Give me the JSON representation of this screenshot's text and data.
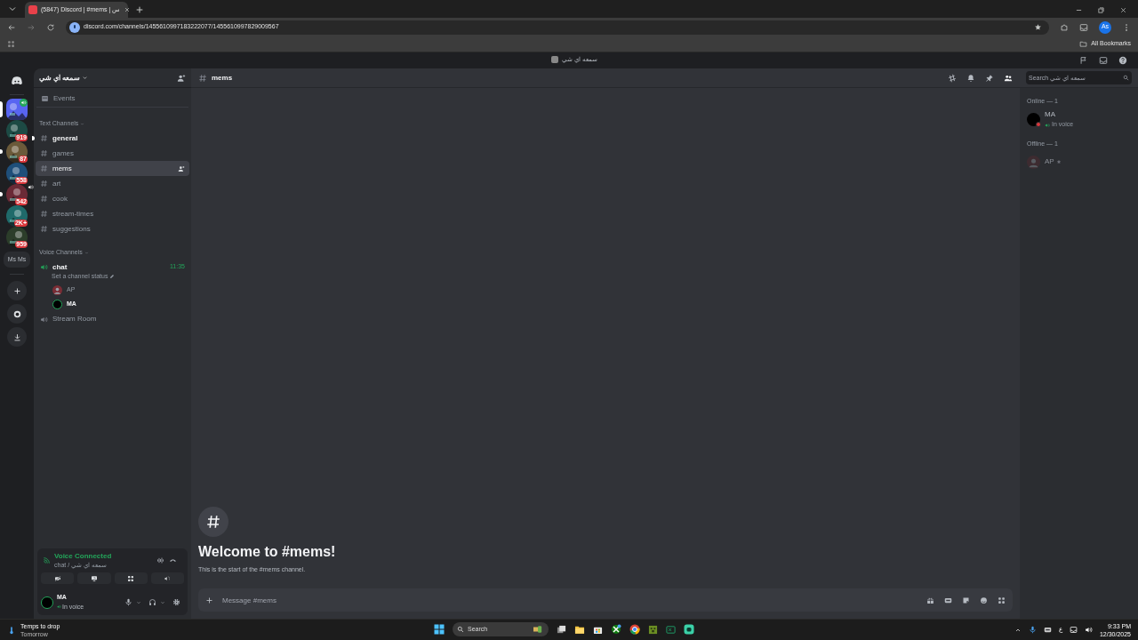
{
  "browser": {
    "tab_title": "(5847) Discord | #mems | س",
    "address": "discord.com/channels/1455610997183222077/1455610997829009567",
    "bookmarks_label": "All Bookmarks",
    "profile_initials": "As"
  },
  "app_title": "سمعه اي شي",
  "servers": [
    {
      "selected": true,
      "speaker": true
    },
    {
      "badge": "919",
      "selected": false,
      "unread": false,
      "speaker": false
    },
    {
      "badge": "87",
      "selected": false,
      "unread": true,
      "speaker": false
    },
    {
      "badge": "558",
      "selected": false,
      "unread": false,
      "speaker": false
    },
    {
      "badge": "542",
      "selected": false,
      "unread": true,
      "speaker": true
    },
    {
      "badge": "2K+",
      "selected": false,
      "unread": false,
      "speaker": false
    },
    {
      "badge": "959",
      "selected": false,
      "unread": false,
      "speaker": false
    }
  ],
  "server_folder": "Ms Ms",
  "server_name": "سمعه اي شي",
  "events_label": "Events",
  "text_category": "Text Channels",
  "text_channels": [
    {
      "name": "general",
      "selected": false,
      "unread": true
    },
    {
      "name": "games",
      "selected": false,
      "unread": false
    },
    {
      "name": "mems",
      "selected": true,
      "unread": false
    },
    {
      "name": "art",
      "selected": false,
      "unread": false
    },
    {
      "name": "cook",
      "selected": false,
      "unread": false
    },
    {
      "name": "stream-times",
      "selected": false,
      "unread": false
    },
    {
      "name": "suggestions",
      "selected": false,
      "unread": false
    }
  ],
  "voice_category": "Voice Channels",
  "voice_channels": [
    {
      "name": "chat",
      "active": true,
      "time": "11:35",
      "status": "Set a channel status",
      "users": [
        {
          "name": "AP",
          "bold": false
        },
        {
          "name": "MA",
          "bold": true
        }
      ]
    },
    {
      "name": "Stream Room",
      "active": false
    }
  ],
  "voice_panel": {
    "title": "Voice Connected",
    "subtitle": "chat / سمعه اي شي"
  },
  "user_panel": {
    "name": "MA",
    "status": "In voice"
  },
  "channel_header": {
    "name": "mems",
    "search_placeholder": "Search سمعه اي شي"
  },
  "welcome": {
    "title": "Welcome to #mems!",
    "text": "This is the start of the #mems channel."
  },
  "composer": {
    "placeholder": "Message #mems"
  },
  "members": [
    {
      "heading": "Online — 1",
      "people": [
        {
          "name": "MA",
          "status": "In voice",
          "online": true
        }
      ]
    },
    {
      "heading": "Offline — 1",
      "people": [
        {
          "name": "AP",
          "online": false
        }
      ]
    }
  ],
  "taskbar": {
    "weather_title": "Temps to drop",
    "weather_sub": "Tomorrow",
    "search": "Search",
    "lang": "ع",
    "time": "9:33 PM",
    "date": "12/30/2025"
  }
}
